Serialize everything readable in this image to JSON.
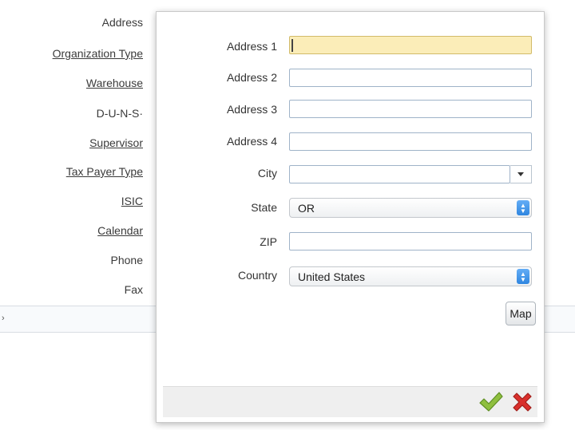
{
  "background_form": {
    "labels": {
      "address": "Address",
      "organization_type": "Organization Type",
      "warehouse": "Warehouse",
      "duns": "D-U-N-S·",
      "supervisor": "Supervisor",
      "tax_payer_type": "Tax Payer Type",
      "isic": "ISIC",
      "calendar": "Calendar",
      "phone": "Phone",
      "fax": "Fax"
    },
    "strip_mark": "›"
  },
  "dialog": {
    "fields": {
      "address1": {
        "label": "Address 1",
        "value": ""
      },
      "address2": {
        "label": "Address 2",
        "value": ""
      },
      "address3": {
        "label": "Address 3",
        "value": ""
      },
      "address4": {
        "label": "Address 4",
        "value": ""
      },
      "city": {
        "label": "City",
        "value": ""
      },
      "state": {
        "label": "State",
        "value": "OR"
      },
      "zip": {
        "label": "ZIP",
        "value": ""
      },
      "country": {
        "label": "Country",
        "value": "United States"
      }
    },
    "map_button_label": "Map",
    "icons": {
      "confirm": "checkmark-icon",
      "cancel": "x-icon"
    },
    "colors": {
      "focus_background": "#fbedb8",
      "select_button": "#2f86e0",
      "confirm_green": "#8fbf3f",
      "cancel_red": "#d9302c"
    }
  }
}
